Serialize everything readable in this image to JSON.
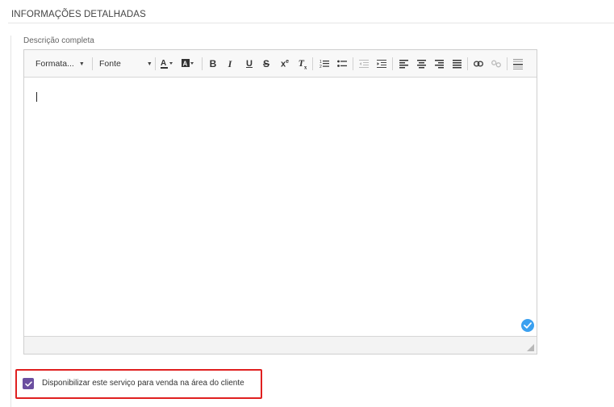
{
  "section": {
    "title": "INFORMAÇÕES DETALHADAS"
  },
  "field": {
    "label": "Descrição completa"
  },
  "toolbar": {
    "format_label": "Formata...",
    "font_label": "Fonte",
    "buttons": {
      "text_color": "text-color-icon",
      "bg_color": "background-color-icon",
      "bold": "B",
      "italic": "I",
      "underline": "U",
      "strike": "S",
      "superscript": "x",
      "superscript_mark": "e",
      "clear_format": "T",
      "clear_format_mark": "x"
    }
  },
  "colors": {
    "accent": "#6b4fa0",
    "highlight": "#e02020",
    "badge": "#3aa0f0"
  },
  "checkbox": {
    "checked": true,
    "label": "Disponibilizar este serviço para venda na área do cliente"
  }
}
